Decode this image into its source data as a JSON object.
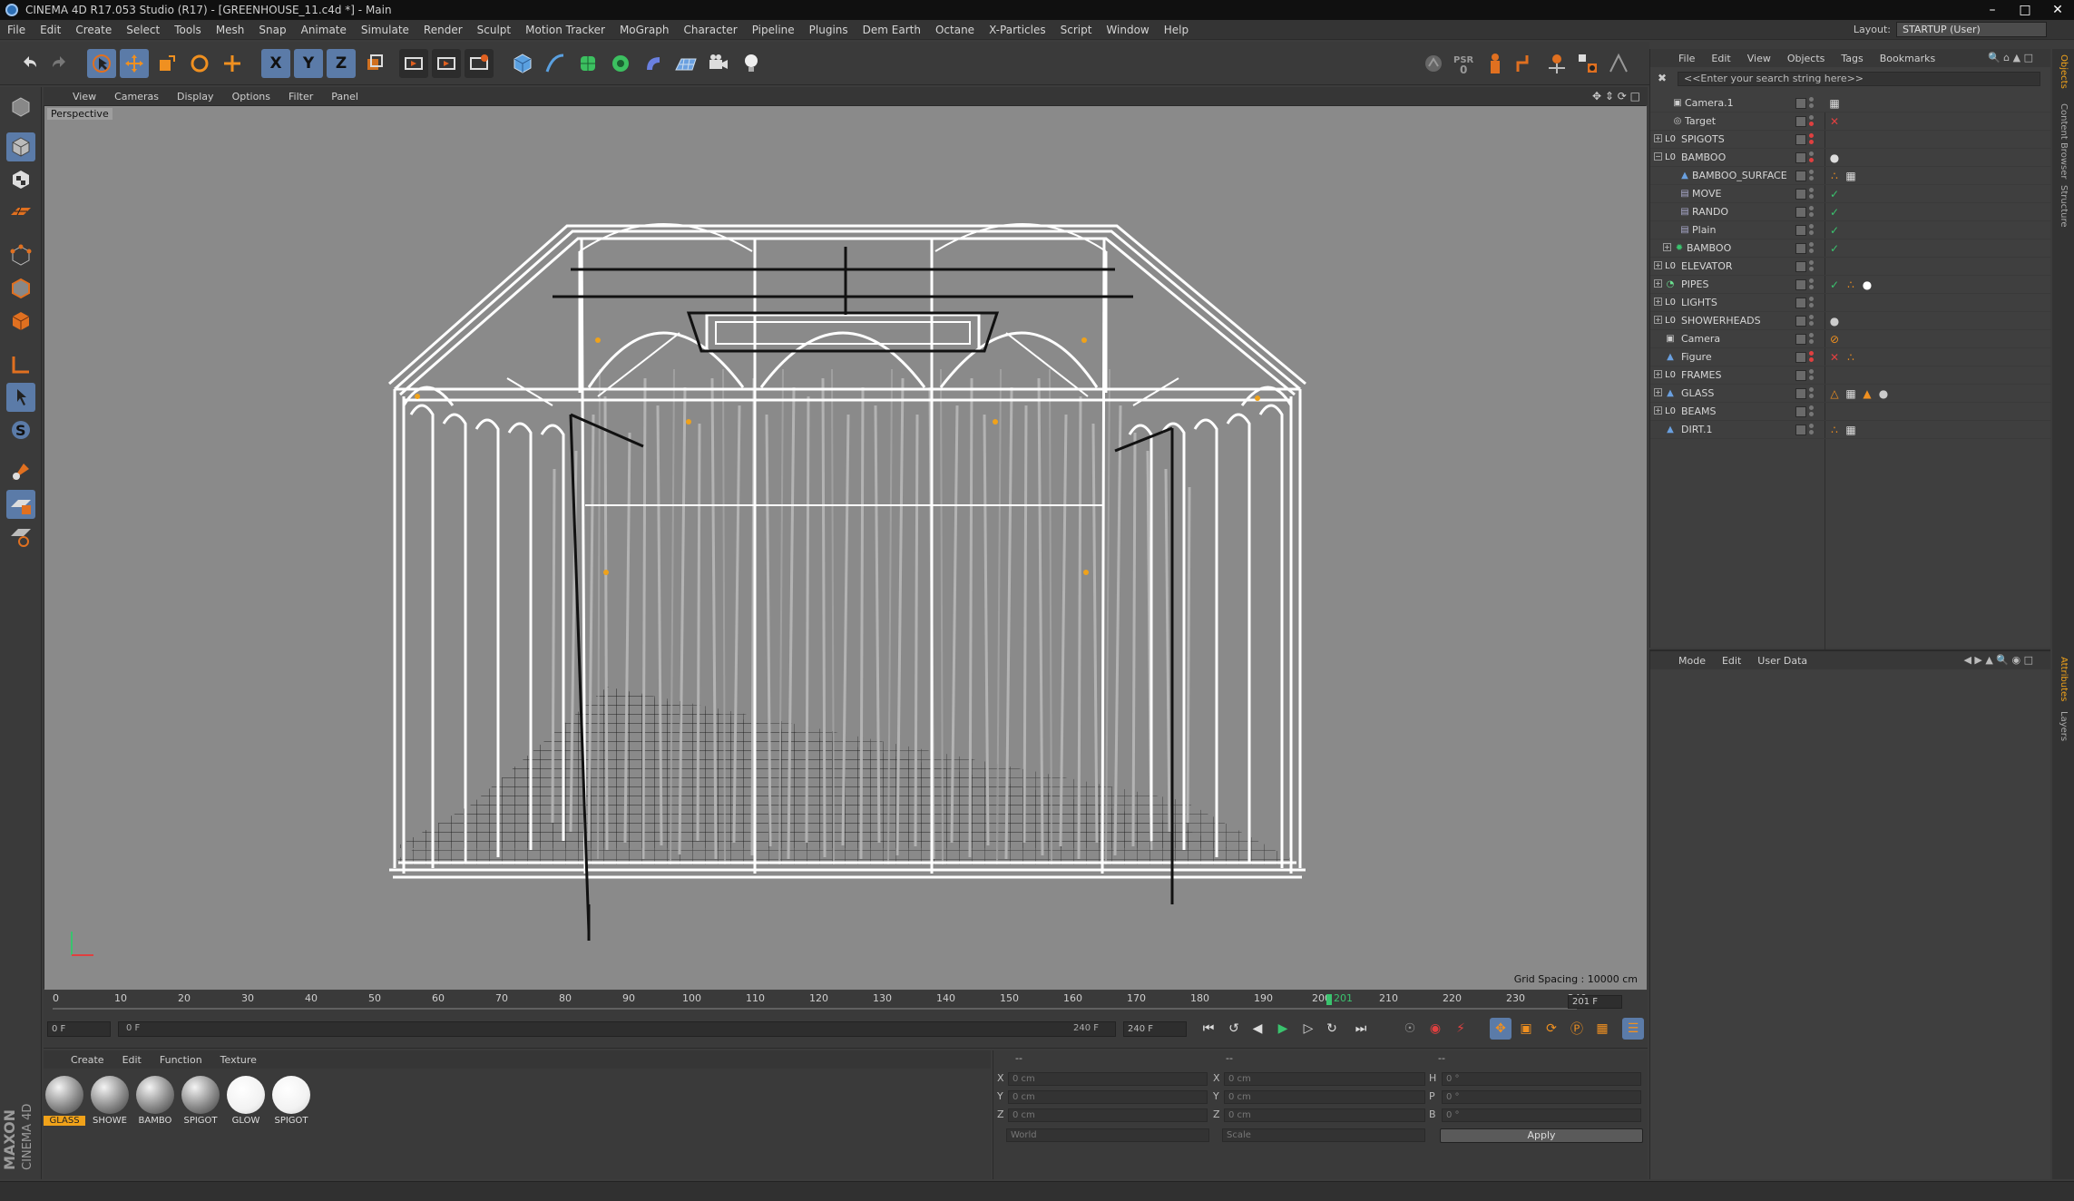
{
  "window": {
    "title": "CINEMA 4D R17.053 Studio (R17) - [GREENHOUSE_11.c4d *] - Main"
  },
  "menubar": {
    "items": [
      "File",
      "Edit",
      "Create",
      "Select",
      "Tools",
      "Mesh",
      "Snap",
      "Animate",
      "Simulate",
      "Render",
      "Sculpt",
      "Motion Tracker",
      "MoGraph",
      "Character",
      "Pipeline",
      "Plugins",
      "Dem Earth",
      "Octane",
      "X-Particles",
      "Script",
      "Window",
      "Help"
    ],
    "layout_label": "Layout:",
    "layout_value": "STARTUP (User)"
  },
  "toolbar": {
    "axis_x": "X",
    "axis_y": "Y",
    "axis_z": "Z"
  },
  "viewport": {
    "menu": [
      "View",
      "Cameras",
      "Display",
      "Options",
      "Filter",
      "Panel"
    ],
    "label": "Perspective",
    "grid_spacing": "Grid Spacing : 10000 cm"
  },
  "timeline": {
    "ticks": [
      "0",
      "10",
      "20",
      "30",
      "40",
      "50",
      "60",
      "70",
      "80",
      "90",
      "100",
      "110",
      "120",
      "130",
      "140",
      "150",
      "160",
      "170",
      "180",
      "190",
      "200",
      "210",
      "220",
      "230",
      "240"
    ],
    "current_frame_label": "201",
    "current_frame_field": "201 F",
    "start_field": "0 F",
    "range_start": "0 F",
    "range_end": "240 F",
    "end_field": "240 F"
  },
  "material_manager": {
    "menu": [
      "Create",
      "Edit",
      "Function",
      "Texture"
    ],
    "materials": [
      {
        "name": "GLASS",
        "selected": true,
        "kind": "gray"
      },
      {
        "name": "SHOWE",
        "selected": false,
        "kind": "gray"
      },
      {
        "name": "BAMBO",
        "selected": false,
        "kind": "gray"
      },
      {
        "name": "SPIGOT",
        "selected": false,
        "kind": "gray"
      },
      {
        "name": "GLOW",
        "selected": false,
        "kind": "white"
      },
      {
        "name": "SPIGOT",
        "selected": false,
        "kind": "white"
      }
    ]
  },
  "coordinates": {
    "header_a": "--",
    "header_b": "--",
    "header_c": "--",
    "pos": {
      "x_label": "X",
      "y_label": "Y",
      "z_label": "Z",
      "x": "0 cm",
      "y": "0 cm",
      "z": "0 cm"
    },
    "size": {
      "x_label": "X",
      "y_label": "Y",
      "z_label": "Z",
      "x": "0 cm",
      "y": "0 cm",
      "z": "0 cm"
    },
    "rot": {
      "h_label": "H",
      "p_label": "P",
      "b_label": "B",
      "h": "0 °",
      "p": "0 °",
      "b": "0 °"
    },
    "mode_world": "World",
    "mode_scale": "Scale",
    "apply": "Apply"
  },
  "object_manager": {
    "menu": [
      "File",
      "Edit",
      "View",
      "Objects",
      "Tags",
      "Bookmarks"
    ],
    "search_placeholder": "<<Enter your search string here>>",
    "objects": [
      {
        "name": "Camera.1",
        "indent": 1,
        "icon": "camera-icon",
        "expand": false
      },
      {
        "name": "Target",
        "indent": 1,
        "icon": "target-icon",
        "expand": false
      },
      {
        "name": "SPIGOTS",
        "indent": 0,
        "icon": "null-icon",
        "expand": true
      },
      {
        "name": "BAMBOO",
        "indent": 0,
        "icon": "null-icon",
        "expand": true
      },
      {
        "name": "BAMBOO_SURFACE",
        "indent": 2,
        "icon": "figure-icon",
        "expand": false
      },
      {
        "name": "MOVE",
        "indent": 2,
        "icon": "effector-icon",
        "expand": false
      },
      {
        "name": "RANDO",
        "indent": 2,
        "icon": "effector-icon",
        "expand": false
      },
      {
        "name": "Plain",
        "indent": 2,
        "icon": "effector-icon",
        "expand": false
      },
      {
        "name": "BAMBOO",
        "indent": 1,
        "icon": "cloner-icon",
        "expand": true
      },
      {
        "name": "ELEVATOR",
        "indent": 0,
        "icon": "null-icon",
        "expand": true
      },
      {
        "name": "PIPES",
        "indent": 0,
        "icon": "sweep-icon",
        "expand": true
      },
      {
        "name": "LIGHTS",
        "indent": 0,
        "icon": "null-icon",
        "expand": true
      },
      {
        "name": "SHOWERHEADS",
        "indent": 0,
        "icon": "null-icon",
        "expand": true
      },
      {
        "name": "Camera",
        "indent": 0,
        "icon": "camera-icon",
        "expand": false
      },
      {
        "name": "Figure",
        "indent": 0,
        "icon": "figure-icon",
        "expand": false
      },
      {
        "name": "FRAMES",
        "indent": 0,
        "icon": "null-icon",
        "expand": true
      },
      {
        "name": "GLASS",
        "indent": 0,
        "icon": "figure-icon",
        "expand": true
      },
      {
        "name": "BEAMS",
        "indent": 0,
        "icon": "null-icon",
        "expand": true
      },
      {
        "name": "DIRT.1",
        "indent": 0,
        "icon": "figure-icon",
        "expand": false
      }
    ]
  },
  "attribute_manager": {
    "menu": [
      "Mode",
      "Edit",
      "User Data"
    ]
  },
  "side_tabs": {
    "objects": "Objects",
    "content_browser": "Content Browser",
    "structure": "Structure",
    "attributes": "Attributes",
    "layers": "Layers"
  },
  "branding": {
    "maxon": "MAXON",
    "cinema": "CINEMA 4D"
  },
  "colors": {
    "accent_blue": "#5b7ba8",
    "selection_orange": "#f0a21a",
    "playhead_green": "#3ac36e"
  }
}
